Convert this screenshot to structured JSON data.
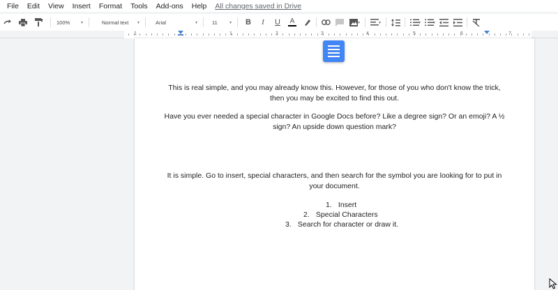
{
  "menu": {
    "items": [
      "File",
      "Edit",
      "View",
      "Insert",
      "Format",
      "Tools",
      "Add-ons",
      "Help"
    ],
    "saved_status": "All changes saved in Drive"
  },
  "toolbar": {
    "zoom": "100%",
    "style": "Normal text",
    "font": "Arial",
    "font_size": "11",
    "bold_label": "B",
    "italic_label": "I",
    "underline_label": "U",
    "text_color_label": "A"
  },
  "ruler": {
    "numbers": [
      "1",
      "1",
      "2",
      "3",
      "4",
      "5",
      "6",
      "7"
    ]
  },
  "document": {
    "paragraphs": [
      "This is real simple, and you may already know this. However, for those of you who don't know the trick, then you may be excited to find this out.",
      "Have you ever needed a special character in Google Docs before? Like a degree sign? Or an emoji? A ½ sign? An upside down question mark?",
      "It is simple. Go to insert, special characters, and then search for the symbol you are looking for to put in your document."
    ],
    "list": [
      {
        "marker": "1.",
        "text": "Insert"
      },
      {
        "marker": "2.",
        "text": "Special Characters"
      },
      {
        "marker": "3.",
        "text": "Search for character or draw it."
      }
    ]
  },
  "colors": {
    "accent": "#4285f4",
    "page": "#ffffff",
    "background": "#f1f3f4"
  }
}
